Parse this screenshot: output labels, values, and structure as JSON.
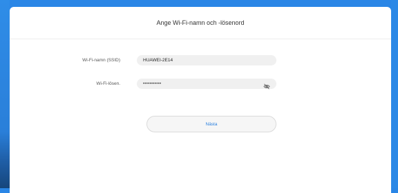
{
  "dialog": {
    "title": "Ange Wi-Fi-namn och -lösenord"
  },
  "ssid": {
    "label": "Wi-Fi-namn (SSID)",
    "value": "HUAWEI-2E14"
  },
  "password": {
    "label": "Wi-Fi-lösen.",
    "masked_value": "•••••••••••",
    "toggle_icon": "eye-off-icon"
  },
  "next_button": {
    "label": "Nästa"
  },
  "colors": {
    "background": "#2a86e6",
    "accent": "#2a7fde",
    "field_bg": "#f0f0f0"
  }
}
